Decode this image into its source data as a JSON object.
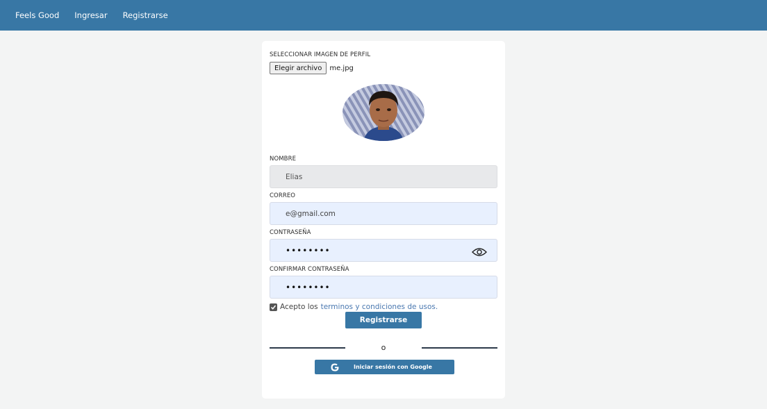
{
  "navbar": {
    "brand": "Feels Good",
    "links": [
      "Ingresar",
      "Registrarse"
    ]
  },
  "form": {
    "profile_image_label": "SELECCIONAR IMAGEN DE PERFIL",
    "file_button": "Elegir archivo",
    "file_name": "me.jpg",
    "name_label": "NOMBRE",
    "name_value": "Elias",
    "email_label": "CORREO",
    "email_value": "e@gmail.com",
    "password_label": "CONTRASEÑA",
    "password_value": "••••••••",
    "confirm_label": "CONFIRMAR CONTRASEÑA",
    "confirm_value": "••••••••",
    "terms_prefix": "Acepto los",
    "terms_link": "terminos y condiciones de usos.",
    "terms_checked": true,
    "register_button": "Registrarse",
    "divider_text": "o",
    "google_button": "Iniciar sesión con Google"
  },
  "colors": {
    "primary": "#3877a5",
    "background": "#f3f4f4",
    "input_filled": "#e8f0fe",
    "input_disabled": "#e8e9eb",
    "link": "#4a78b0"
  }
}
